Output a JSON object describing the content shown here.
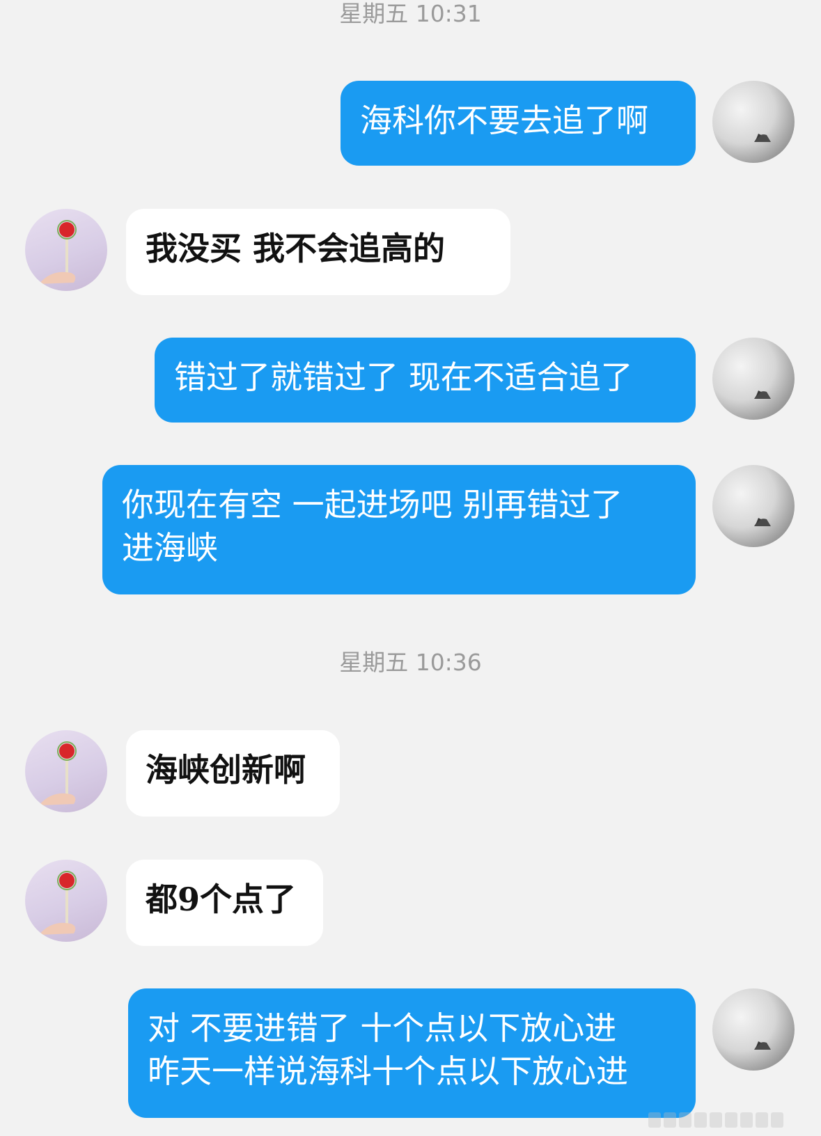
{
  "timestamps": [
    "星期五 10:31",
    "星期五 10:36"
  ],
  "messages": [
    {
      "sender": "self",
      "text": "海科你不要去追了啊"
    },
    {
      "sender": "other",
      "text": "我没买  我不会追高的"
    },
    {
      "sender": "self",
      "text": "错过了就错过了 现在不适合追了"
    },
    {
      "sender": "self",
      "text": "你现在有空 一起进场吧 别再错过了\n进海峡"
    },
    {
      "sender": "other",
      "text": "海峡创新啊"
    },
    {
      "sender": "other",
      "text": "都9个点了"
    },
    {
      "sender": "self",
      "text": "对 不要进错了 十个点以下放心进\n昨天一样说海科十个点以下放心进"
    }
  ],
  "colors": {
    "background": "#f2f2f2",
    "sent_bubble": "#1a9bf2",
    "received_bubble": "#ffffff",
    "timestamp_text": "#9a9a9a"
  },
  "icons": {
    "self_avatar": "grey-landscape-avatar-icon",
    "other_avatar": "lollipop-avatar-icon"
  }
}
